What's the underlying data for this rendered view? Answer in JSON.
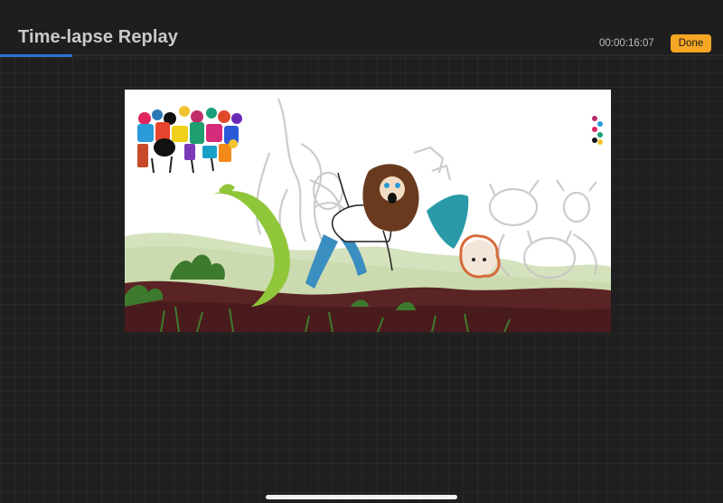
{
  "header": {
    "title": "Time-lapse Replay",
    "timestamp": "00:00:16:07",
    "done_label": "Done"
  },
  "playback": {
    "progress_percent": 10
  },
  "colors": {
    "accent": "#2f6fd8",
    "done_button": "#f5a623",
    "background": "#1f1f1f"
  },
  "icons": {
    "home_indicator": "home-indicator-bar"
  }
}
